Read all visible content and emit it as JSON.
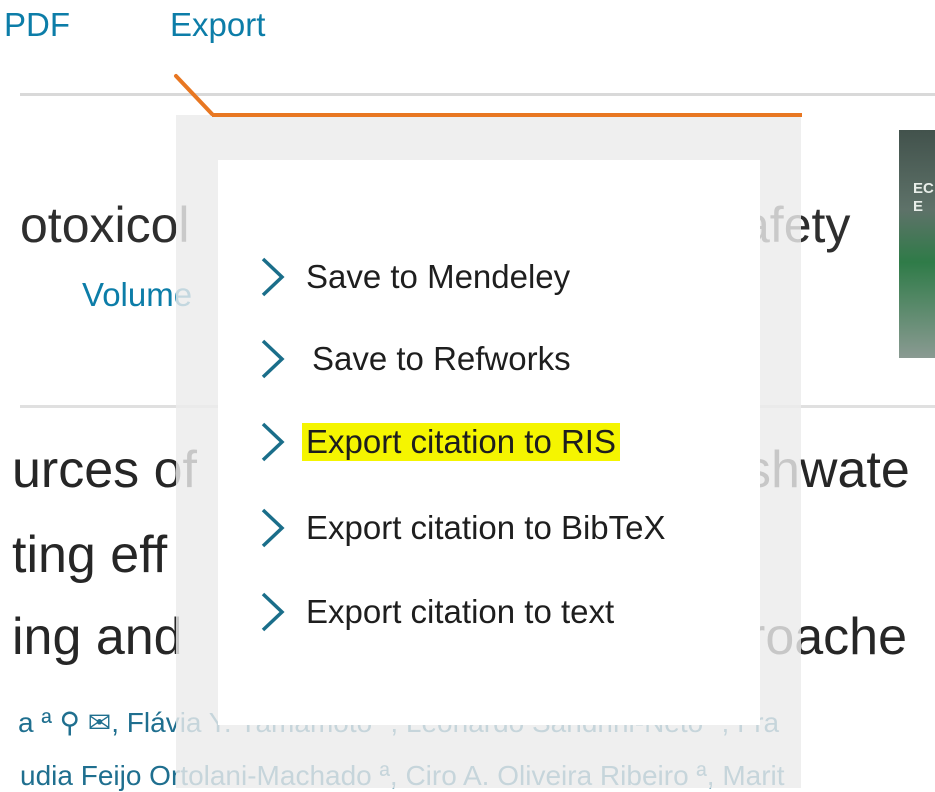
{
  "toolbar": {
    "pdf_label": "PDF",
    "export_label": "Export"
  },
  "article": {
    "journal_title_left": "otoxicol",
    "journal_title_right": "afety",
    "volume_text": "Volume",
    "cover_text": "EC\nE",
    "headline_lines": [
      {
        "left": "urces of",
        "right": "shwate"
      },
      {
        "left": "ting eff",
        "right": ""
      },
      {
        "left": "ing and",
        "right": "roache"
      }
    ],
    "authors_line_1": "a ª ⚲ ✉, Flávia Y. Yamamoto ª, Leonardo Sandrini-Neto ᵇ, Fra",
    "authors_line_2": "udia Feijo Ortolani-Machado ª, Ciro A. Oliveira Ribeiro ª, Marit"
  },
  "export_menu": {
    "items": [
      {
        "label": "Save to Mendeley",
        "icon": "chevron-right-icon",
        "highlighted": false
      },
      {
        "label": "Save to Refworks",
        "icon": "chevron-right-icon",
        "highlighted": false
      },
      {
        "label": "Export citation to RIS",
        "icon": "chevron-right-icon",
        "highlighted": true
      },
      {
        "label": "Export citation to BibTeX",
        "icon": "chevron-right-icon",
        "highlighted": false
      },
      {
        "label": "Export citation to text",
        "icon": "chevron-right-icon",
        "highlighted": false
      }
    ]
  },
  "colors": {
    "link_blue": "#0c7da8",
    "accent_orange": "#e87722",
    "highlight_yellow": "#f5f500",
    "chevron_teal": "#1a6e8a"
  }
}
